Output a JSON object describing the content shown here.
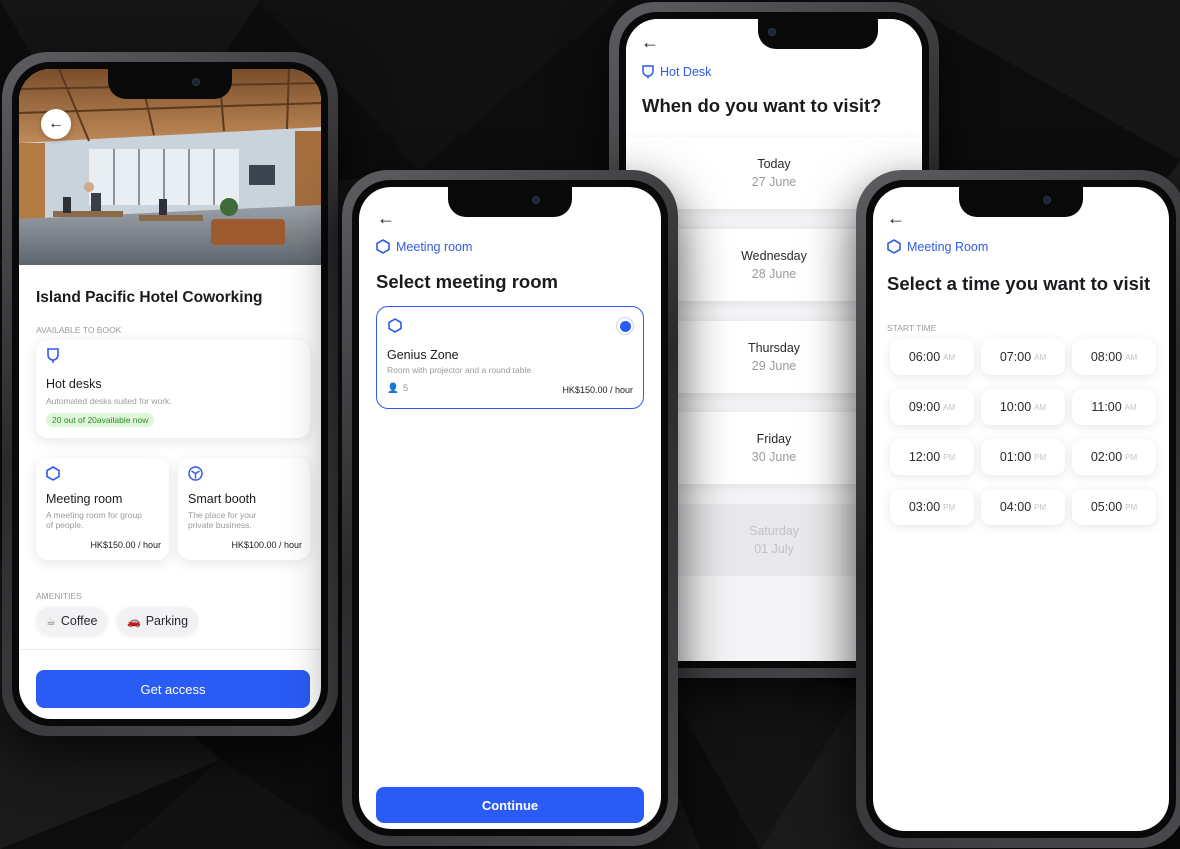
{
  "colors": {
    "accent": "#2b5bf5",
    "ok_bg": "#dff7d8",
    "ok_text": "#2f8a2f"
  },
  "phone1": {
    "venue_title": "Island Pacific Hotel Coworking",
    "available_label": "AVAILABLE TO BOOK",
    "hot_desks": {
      "title": "Hot desks",
      "subtitle": "Automated desks suited for work.",
      "availability": "20 out of 20available now",
      "icon": "desk-lamp-icon"
    },
    "meeting_room": {
      "title": "Meeting room",
      "subtitle": "A meeting room for group of people.",
      "price": "HK$150.00 / hour",
      "icon": "hexagon-icon"
    },
    "smart_booth": {
      "title": "Smart booth",
      "subtitle": "The place for your private business.",
      "price": "HK$100.00 / hour",
      "icon": "cube-icon"
    },
    "amenities_label": "AMENITIES",
    "amenities": [
      {
        "label": "Coffee",
        "icon": "coffee-icon"
      },
      {
        "label": "Parking",
        "icon": "car-icon"
      }
    ],
    "cta": "Get access"
  },
  "phone2": {
    "kicker": "Meeting room",
    "title": "Select meeting room",
    "room": {
      "name": "Genius Zone",
      "desc": "Room with projector and a round table",
      "capacity": "5",
      "price": "HK$150.00 / hour",
      "selected": true
    },
    "cta": "Continue"
  },
  "phone3": {
    "kicker": "Hot Desk",
    "title": "When do you want to visit?",
    "days": [
      {
        "day": "Today",
        "date": "27 June",
        "disabled": false
      },
      {
        "day": "Wednesday",
        "date": "28 June",
        "disabled": false
      },
      {
        "day": "Thursday",
        "date": "29 June",
        "disabled": false
      },
      {
        "day": "Friday",
        "date": "30 June",
        "disabled": false
      },
      {
        "day": "Saturday",
        "date": "01 July",
        "disabled": true
      }
    ]
  },
  "phone4": {
    "kicker": "Meeting Room",
    "title": "Select a time you want to visit",
    "start_label": "START TIME",
    "slots": [
      {
        "time": "06:00",
        "ampm": "AM"
      },
      {
        "time": "07:00",
        "ampm": "AM"
      },
      {
        "time": "08:00",
        "ampm": "AM"
      },
      {
        "time": "09:00",
        "ampm": "AM"
      },
      {
        "time": "10:00",
        "ampm": "AM"
      },
      {
        "time": "11:00",
        "ampm": "AM"
      },
      {
        "time": "12:00",
        "ampm": "PM"
      },
      {
        "time": "01:00",
        "ampm": "PM"
      },
      {
        "time": "02:00",
        "ampm": "PM"
      },
      {
        "time": "03:00",
        "ampm": "PM"
      },
      {
        "time": "04:00",
        "ampm": "PM"
      },
      {
        "time": "05:00",
        "ampm": "PM"
      }
    ]
  }
}
